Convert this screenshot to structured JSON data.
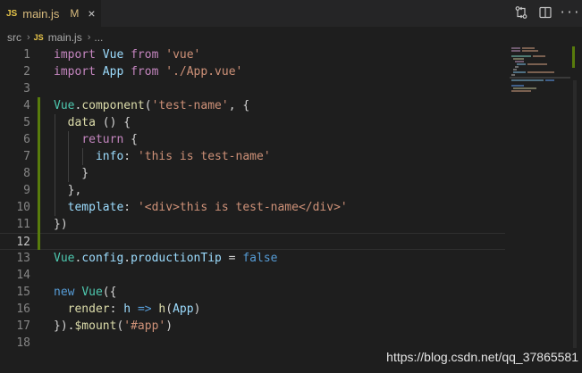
{
  "tab": {
    "file_badge": "JS",
    "title": "main.js",
    "modified": "M",
    "close": "×"
  },
  "actions": [
    {
      "icon": "compare-changes-icon"
    },
    {
      "icon": "split-editor-icon"
    },
    {
      "icon": "more-actions-icon",
      "glyph": "···"
    }
  ],
  "breadcrumb": {
    "folder": "src",
    "sep": "›",
    "file_badge": "JS",
    "file": "main.js",
    "sep2": "›",
    "tail": "..."
  },
  "lines": [
    {
      "n": "1",
      "tokens": [
        [
          "kw",
          "import"
        ],
        [
          "pn",
          " "
        ],
        [
          "vr",
          "Vue"
        ],
        [
          "pn",
          " "
        ],
        [
          "kw",
          "from"
        ],
        [
          "pn",
          " "
        ],
        [
          "str",
          "'vue'"
        ]
      ]
    },
    {
      "n": "2",
      "tokens": [
        [
          "kw",
          "import"
        ],
        [
          "pn",
          " "
        ],
        [
          "vr",
          "App"
        ],
        [
          "pn",
          " "
        ],
        [
          "kw",
          "from"
        ],
        [
          "pn",
          " "
        ],
        [
          "str",
          "'./App.vue'"
        ]
      ]
    },
    {
      "n": "3",
      "tokens": []
    },
    {
      "n": "4",
      "tokens": [
        [
          "tp",
          "Vue"
        ],
        [
          "pn",
          "."
        ],
        [
          "fn",
          "component"
        ],
        [
          "pn",
          "("
        ],
        [
          "str",
          "'test-name'"
        ],
        [
          "pn",
          ", {"
        ]
      ]
    },
    {
      "n": "5",
      "tokens": [
        [
          "pn",
          "  "
        ],
        [
          "fn",
          "data"
        ],
        [
          "pn",
          " () {"
        ]
      ]
    },
    {
      "n": "6",
      "tokens": [
        [
          "pn",
          "    "
        ],
        [
          "kw",
          "return"
        ],
        [
          "pn",
          " {"
        ]
      ]
    },
    {
      "n": "7",
      "tokens": [
        [
          "pn",
          "      "
        ],
        [
          "prop",
          "info"
        ],
        [
          "pn",
          ": "
        ],
        [
          "str",
          "'this is test-name'"
        ]
      ]
    },
    {
      "n": "8",
      "tokens": [
        [
          "pn",
          "    }"
        ]
      ]
    },
    {
      "n": "9",
      "tokens": [
        [
          "pn",
          "  },"
        ]
      ]
    },
    {
      "n": "10",
      "tokens": [
        [
          "pn",
          "  "
        ],
        [
          "prop",
          "template"
        ],
        [
          "pn",
          ": "
        ],
        [
          "str",
          "'<div>this is test-name</div>'"
        ]
      ]
    },
    {
      "n": "11",
      "tokens": [
        [
          "pn",
          "})"
        ]
      ]
    },
    {
      "n": "12",
      "tokens": []
    },
    {
      "n": "13",
      "tokens": [
        [
          "tp",
          "Vue"
        ],
        [
          "pn",
          "."
        ],
        [
          "prop",
          "config"
        ],
        [
          "pn",
          "."
        ],
        [
          "prop",
          "productionTip"
        ],
        [
          "pn",
          " = "
        ],
        [
          "kw2",
          "false"
        ]
      ]
    },
    {
      "n": "14",
      "tokens": []
    },
    {
      "n": "15",
      "tokens": [
        [
          "kw2",
          "new"
        ],
        [
          "pn",
          " "
        ],
        [
          "tp",
          "Vue"
        ],
        [
          "pn",
          "({"
        ]
      ]
    },
    {
      "n": "16",
      "tokens": [
        [
          "pn",
          "  "
        ],
        [
          "fn",
          "render"
        ],
        [
          "pn",
          ": "
        ],
        [
          "vr",
          "h"
        ],
        [
          "pn",
          " "
        ],
        [
          "kw2",
          "=>"
        ],
        [
          "pn",
          " "
        ],
        [
          "fn",
          "h"
        ],
        [
          "pn",
          "("
        ],
        [
          "vr",
          "App"
        ],
        [
          "pn",
          ")"
        ]
      ]
    },
    {
      "n": "17",
      "tokens": [
        [
          "pn",
          "})."
        ],
        [
          "fn",
          "$mount"
        ],
        [
          "pn",
          "("
        ],
        [
          "str",
          "'#app'"
        ],
        [
          "pn",
          ")"
        ]
      ]
    },
    {
      "n": "18",
      "tokens": []
    }
  ],
  "active_line": "12",
  "watermark": "https://blog.csdn.net/qq_37865581",
  "colors": {
    "background": "#1e1e1e",
    "tab_bar": "#252526",
    "modified": "#d7ba7d",
    "git_added": "#587c0c"
  }
}
